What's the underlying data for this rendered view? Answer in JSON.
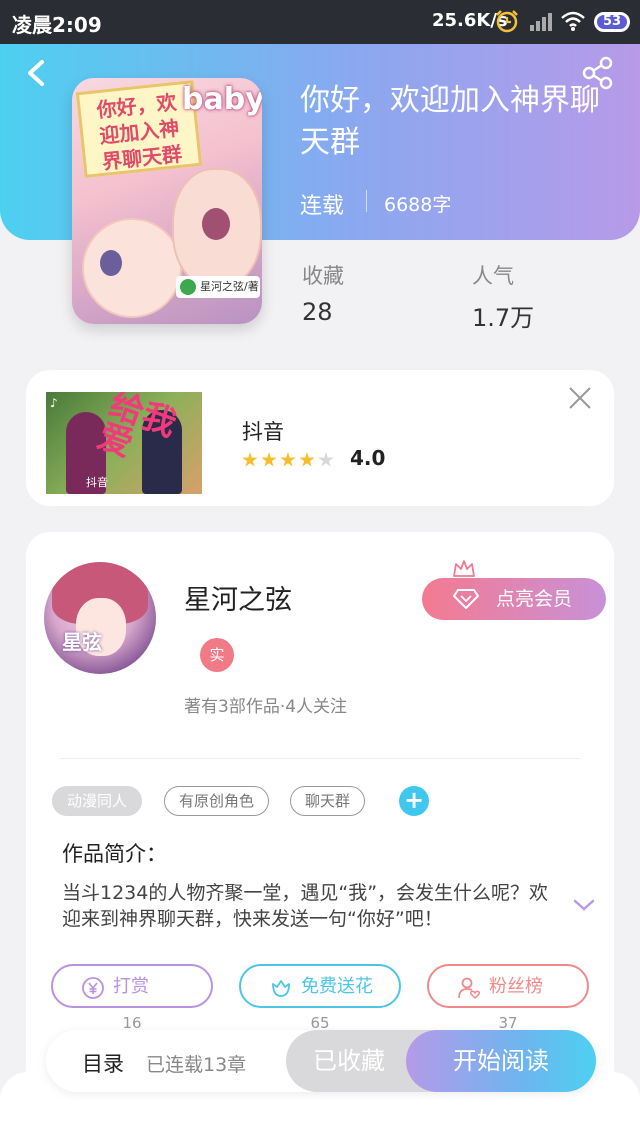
{
  "status_bar": {
    "time": "凌晨2:09",
    "net_speed": "25.6K/s",
    "battery": "53"
  },
  "header": {
    "back_icon": "back-arrow-icon",
    "share_icon": "share-icon"
  },
  "book": {
    "title": "你好，欢迎加入神界聊天群",
    "status": "连载",
    "word_count": "6688字",
    "cover": {
      "label": "你好，欢\n迎加入神\n界聊天群",
      "baby_text": "baby",
      "author_text": "星河之弦/著"
    },
    "stats": [
      {
        "label": "收藏",
        "value": "28"
      },
      {
        "label": "人气",
        "value": "1.7万"
      }
    ]
  },
  "ad": {
    "name": "抖音",
    "rating": "4.0",
    "rating_value": 4,
    "rating_max": 5,
    "thumb_text": "给我爱",
    "thumb_tag": "♪",
    "thumb_bottom": "抖音"
  },
  "author": {
    "name": "星河之弦",
    "real_badge": "实",
    "meta": "著有3部作品·4人关注",
    "avatar_text": "星弦",
    "vip_button": "点亮会员"
  },
  "tags": [
    "动漫同人",
    "有原创角色",
    "聊天群"
  ],
  "tag_add": "+",
  "intro": {
    "title": "作品简介：",
    "text": "当斗1234的人物齐聚一堂，遇见“我”，会发生什么呢？欢迎来到神界聊天群，快来发送一句“你好”吧！"
  },
  "actions": [
    {
      "label": "打赏",
      "count": "16",
      "color": "#b892e0"
    },
    {
      "label": "免费送花",
      "count": "65",
      "color": "#4cc6e6"
    },
    {
      "label": "粉丝榜",
      "count": "37",
      "color": "#f08a8a"
    }
  ],
  "bottom": {
    "toc_label": "目录",
    "toc_count": "已连载13章",
    "collected": "已收藏",
    "read": "开始阅读"
  },
  "colors": {
    "header_gradient_start": "#4dd0f0",
    "header_gradient_end": "#b79ae8",
    "vip_start": "#f47a90",
    "vip_end": "#c891d8",
    "star_on": "#f6be2f",
    "star_off": "#d8d8d8"
  }
}
